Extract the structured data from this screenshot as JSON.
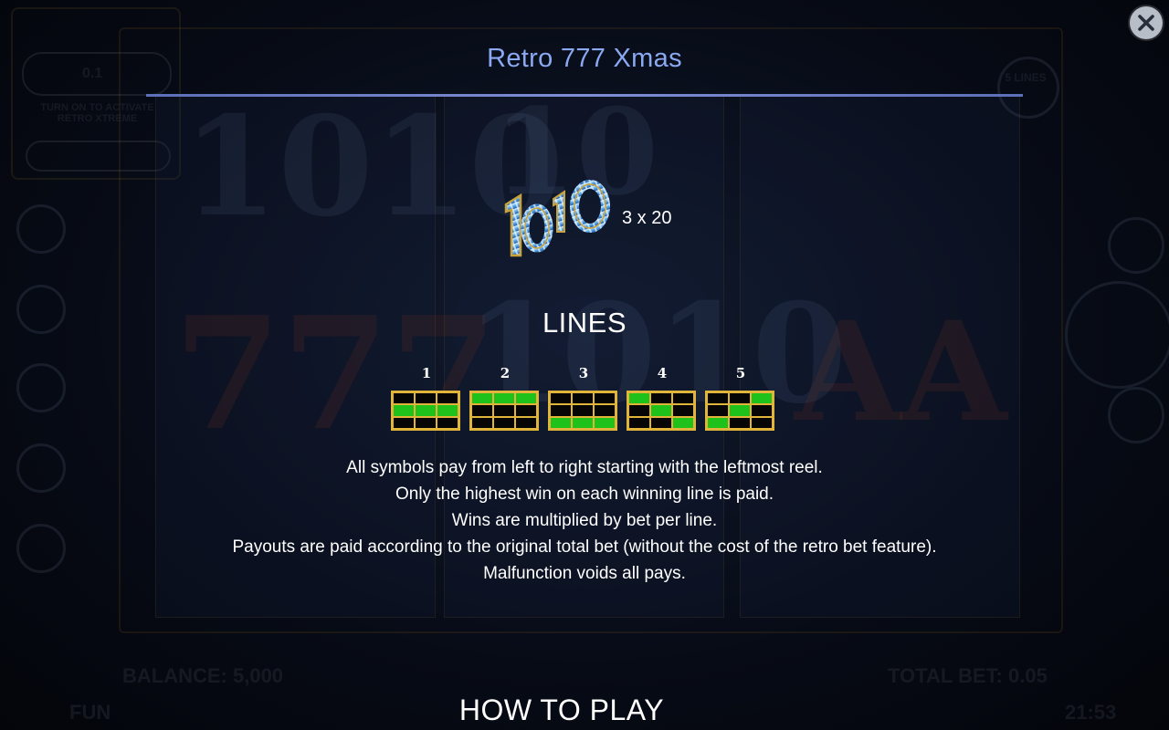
{
  "header": {
    "title": "Retro 777 Xmas"
  },
  "close": {
    "icon": "close-icon"
  },
  "symbol": {
    "name": "1010-symbol",
    "pay": "3 x 20"
  },
  "lines": {
    "heading": "LINES",
    "items": [
      {
        "label": "1",
        "cells": [
          [
            0,
            0,
            0
          ],
          [
            1,
            1,
            1
          ],
          [
            0,
            0,
            0
          ]
        ]
      },
      {
        "label": "2",
        "cells": [
          [
            1,
            1,
            1
          ],
          [
            0,
            0,
            0
          ],
          [
            0,
            0,
            0
          ]
        ]
      },
      {
        "label": "3",
        "cells": [
          [
            0,
            0,
            0
          ],
          [
            0,
            0,
            0
          ],
          [
            1,
            1,
            1
          ]
        ]
      },
      {
        "label": "4",
        "cells": [
          [
            1,
            0,
            0
          ],
          [
            0,
            1,
            0
          ],
          [
            0,
            0,
            1
          ]
        ]
      },
      {
        "label": "5",
        "cells": [
          [
            0,
            0,
            1
          ],
          [
            0,
            1,
            0
          ],
          [
            1,
            0,
            0
          ]
        ]
      }
    ],
    "cell_on_color": "#1ec21a",
    "grid_border_color": "#e0b53a"
  },
  "rules": [
    "All symbols pay from left to right starting with the leftmost reel.",
    "Only the highest win on each winning line is paid.",
    "Wins are multiplied by bet per line.",
    "Payouts are paid according to the original total bet (without the cost of the retro bet feature).",
    "Malfunction voids all pays."
  ],
  "footer": {
    "section_title": "HOW TO PLAY"
  },
  "background": {
    "panel_value": "0.1",
    "panel_hint": "TURN ON TO ACTIVATE RETRO XTREME",
    "lines_badge": "5 LINES",
    "balance": "BALANCE: 5,000",
    "total_bet": "TOTAL BET: 0.05",
    "mode": "FUN",
    "clock": "21:53"
  },
  "colors": {
    "title": "#8aa9f2",
    "accent_rule": "#7f8ed6"
  }
}
